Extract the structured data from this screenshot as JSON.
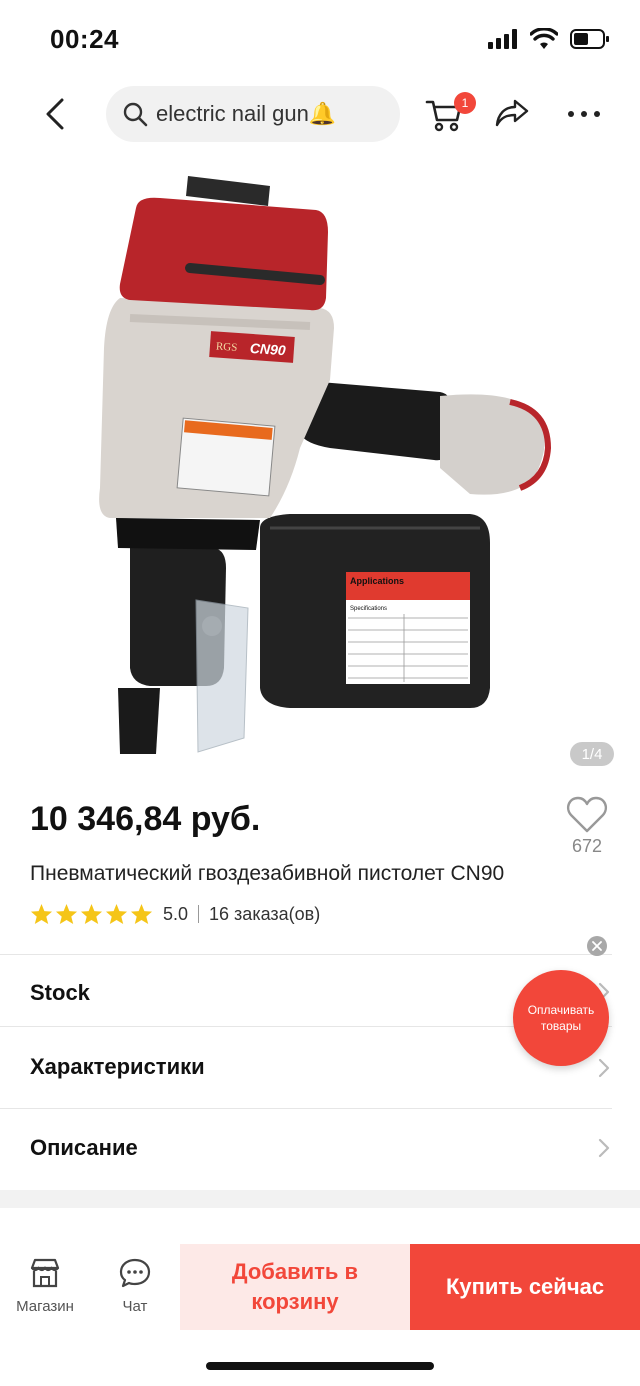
{
  "status_bar": {
    "time": "00:24"
  },
  "search": {
    "query": "electric nail gun🔔"
  },
  "cart": {
    "badge": "1"
  },
  "gallery": {
    "counter": "1/4"
  },
  "product": {
    "price": "10 346,84 руб.",
    "wishlist_count": "672",
    "title": "Пневматический гвоздезабивной пистолет CN90",
    "rating": "5.0",
    "orders": "16 заказа(ов)",
    "image_texts": {
      "brand": "RGS",
      "model": "CN90",
      "label_title": "Applications",
      "spec_title": "Specifications"
    }
  },
  "sections": {
    "stock": "Stock",
    "specs": "Характеристики",
    "description": "Описание"
  },
  "floating_button": {
    "label": "Оплачивать товары"
  },
  "bottom_bar": {
    "store_label": "Магазин",
    "chat_label": "Чат",
    "add_to_cart": "Добавить в корзину",
    "buy_now": "Купить сейчас"
  },
  "colors": {
    "accent": "#f2473a",
    "star": "#f5c518",
    "tool_red": "#b8252a"
  }
}
